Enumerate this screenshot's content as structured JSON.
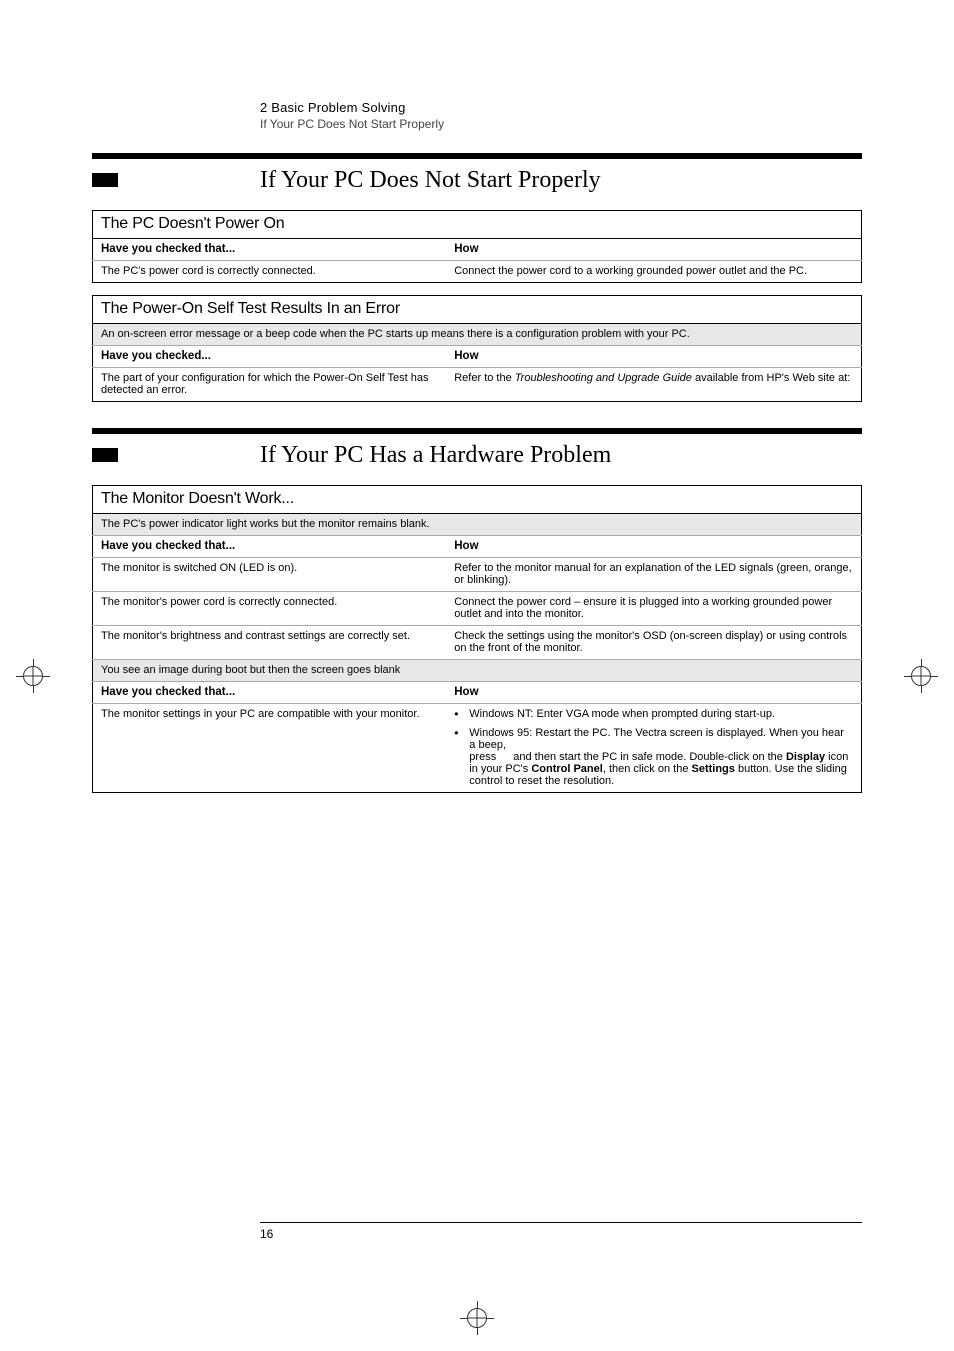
{
  "chapter": {
    "number_title": "2   Basic Problem Solving",
    "running": "If Your PC Does Not Start Properly"
  },
  "heading1": "If Your PC Does Not Start Properly",
  "heading2": "If Your PC Has a Hardware Problem",
  "table_poweron": {
    "section": "The PC Doesn't Power On",
    "col_checked": "Have you checked that...",
    "col_how": "How",
    "rows": [
      {
        "checked": "The PC's power cord is correctly connected.",
        "how": "Connect the power cord to a working grounded power outlet and the PC."
      }
    ]
  },
  "table_post": {
    "section": "The Power-On Self Test Results In an Error",
    "shade_intro": "An on-screen error message or a beep code when the PC starts up means there is a configuration problem with your PC.",
    "col_checked": "Have you checked...",
    "col_how": "How",
    "rows": [
      {
        "checked": "The part of your configuration for which the Power-On Self Test has detected an error.",
        "how_prefix": "Refer to the ",
        "how_em": "Troubleshooting and Upgrade Guide",
        "how_suffix": " available from HP's Web site at:"
      }
    ]
  },
  "table_monitor": {
    "section": "The Monitor Doesn't Work...",
    "shade_intro": "The PC's power indicator light works but the monitor remains blank.",
    "col_checked": "Have you checked that...",
    "col_how": "How",
    "rows1": [
      {
        "checked": "The monitor is switched ON (LED is on).",
        "how": "Refer to the monitor manual for an explanation of the LED signals (green, orange, or blinking)."
      },
      {
        "checked": "The monitor's power cord is correctly connected.",
        "how": "Connect the power cord – ensure it is plugged into a working grounded power outlet and into the monitor."
      },
      {
        "checked": "The monitor's brightness and contrast settings are correctly set.",
        "how": "Check the settings using the monitor's OSD (on-screen display) or using controls on the front of the monitor."
      }
    ],
    "shade_mid": "You see an image during boot but then the screen goes blank",
    "col_checked2": "Have you checked that...",
    "col_how2": "How",
    "rows2": [
      {
        "checked": "The monitor settings in your PC are compatible with your monitor.",
        "bullets": [
          {
            "text": "Windows NT: Enter VGA mode when prompted during start-up."
          },
          {
            "line1": "Windows 95: Restart the PC. The Vectra screen is displayed. When you hear a beep,",
            "press": "press",
            "line2_a": "and then start the PC in safe mode. Double-click on the ",
            "bold1": "Display",
            "line2_b": " icon in your PC's ",
            "bold2": "Control Panel",
            "line2_c": ", then click on the ",
            "bold3": "Settings",
            "line2_d": " button. Use the sliding control to reset the resolution."
          }
        ]
      }
    ]
  },
  "page_number": "16"
}
